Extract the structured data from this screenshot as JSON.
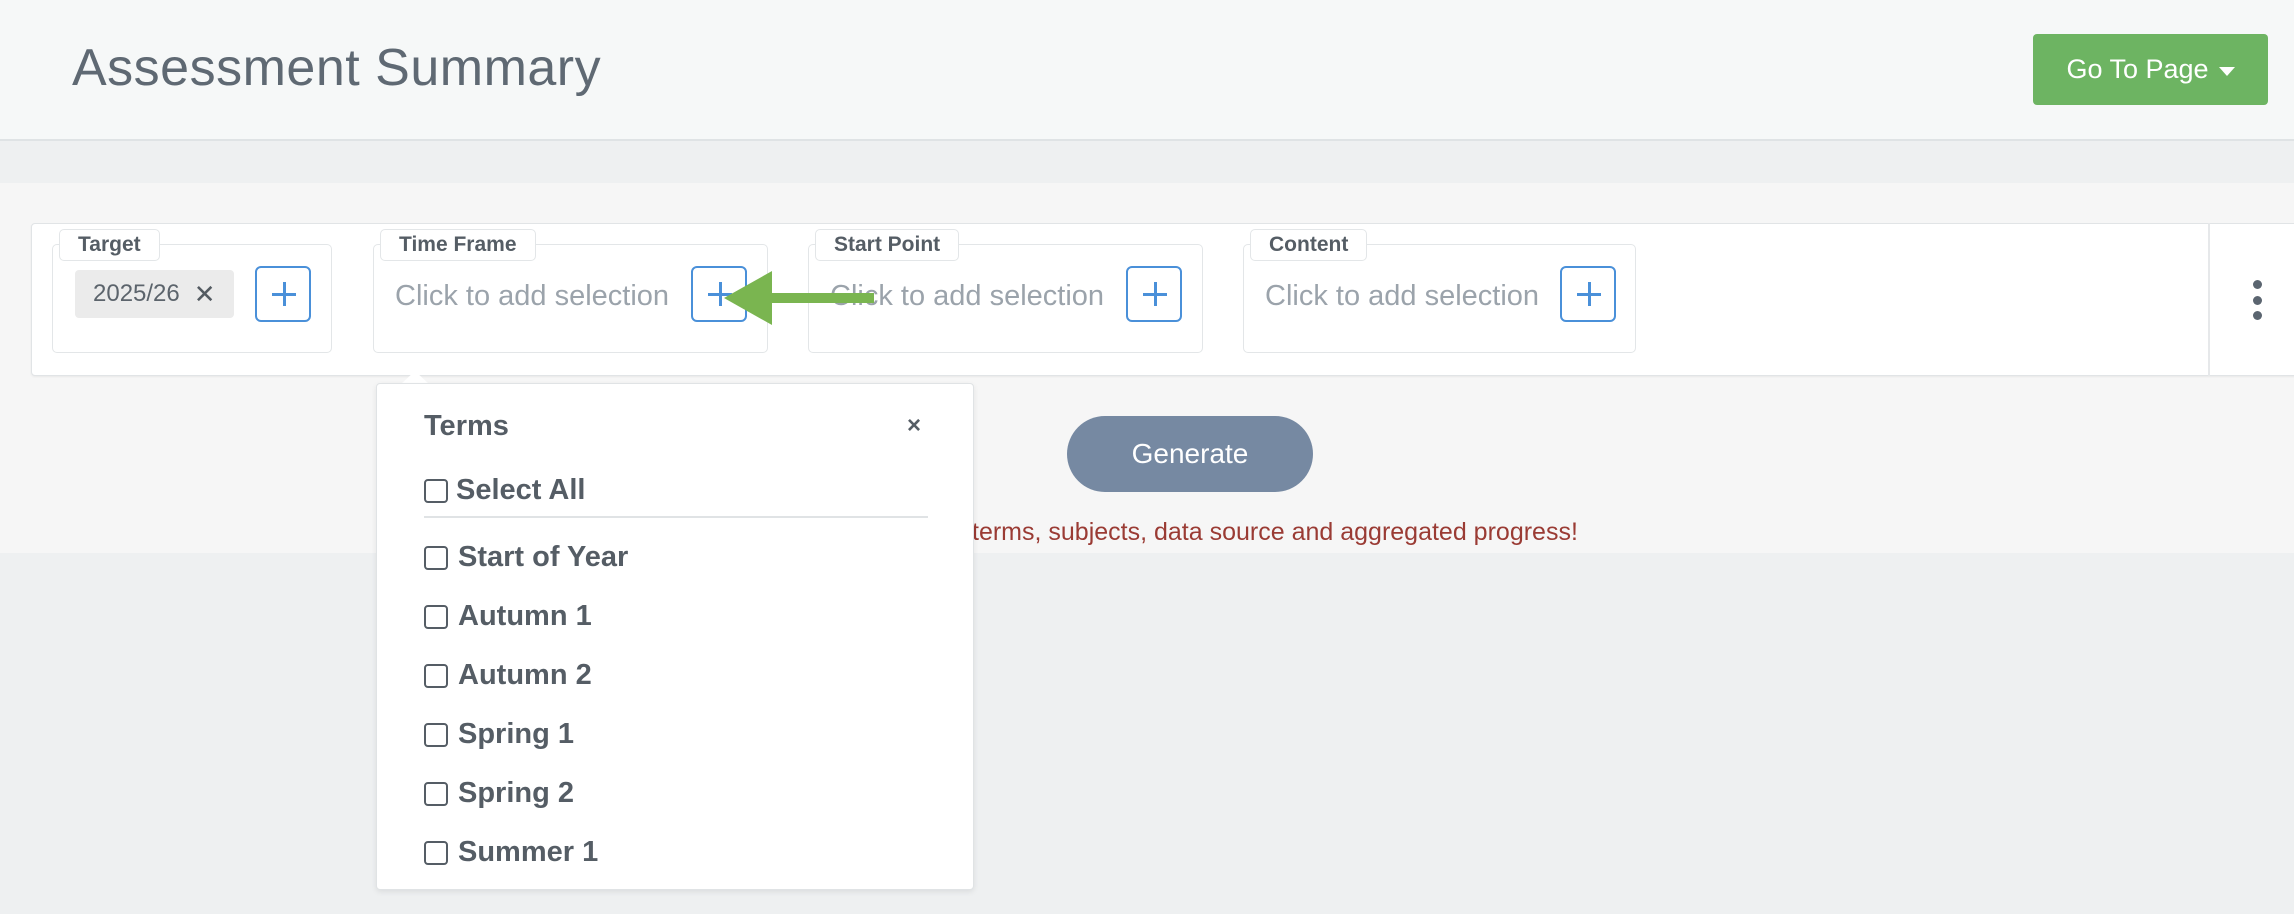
{
  "header": {
    "title": "Assessment Summary",
    "goto_label": "Go To Page"
  },
  "filters": {
    "target": {
      "legend": "Target",
      "chip": "2025/26",
      "chip_remove": "✕"
    },
    "timeframe": {
      "legend": "Time Frame",
      "placeholder": "Click to add selection"
    },
    "startpoint": {
      "legend": "Start Point",
      "placeholder": "Click to add selection"
    },
    "content": {
      "legend": "Content",
      "placeholder": "Click to add selection"
    }
  },
  "dropdown": {
    "title": "Terms",
    "close": "×",
    "select_all": "Select All",
    "options": [
      "Start of Year",
      "Autumn 1",
      "Autumn 2",
      "Spring 1",
      "Spring 2",
      "Summer 1"
    ]
  },
  "generate_label": "Generate",
  "warning_text": "terms, subjects, data source and aggregated progress!",
  "colors": {
    "accent_green": "#6db462",
    "arrow_green": "#7ab550",
    "add_blue": "#4a90d9",
    "generate_slate": "#7689a2",
    "warning_red": "#9a3b34"
  }
}
